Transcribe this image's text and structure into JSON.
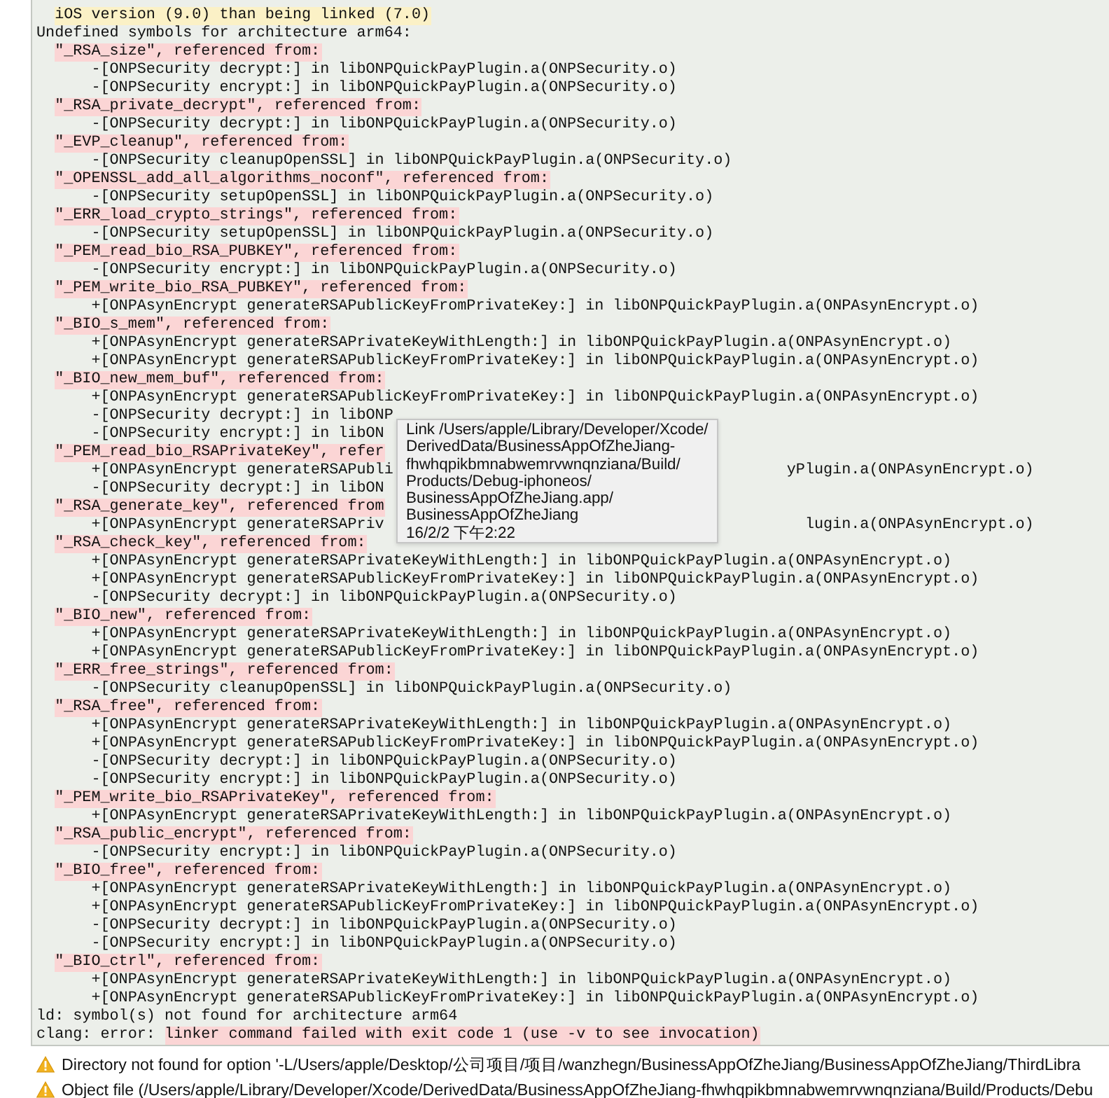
{
  "log": {
    "lines": [
      {
        "kind": "note",
        "text": "iOS version (9.0) than being linked (7.0)"
      },
      {
        "kind": "plain",
        "text": "Undefined symbols for architecture arm64:"
      },
      {
        "kind": "symbol",
        "text": "\"_RSA_size\", referenced from:"
      },
      {
        "kind": "ref",
        "text": "-[ONPSecurity decrypt:] in libONPQuickPayPlugin.a(ONPSecurity.o)"
      },
      {
        "kind": "ref",
        "text": "-[ONPSecurity encrypt:] in libONPQuickPayPlugin.a(ONPSecurity.o)"
      },
      {
        "kind": "symbol",
        "text": "\"_RSA_private_decrypt\", referenced from:"
      },
      {
        "kind": "ref",
        "text": "-[ONPSecurity decrypt:] in libONPQuickPayPlugin.a(ONPSecurity.o)"
      },
      {
        "kind": "symbol",
        "text": "\"_EVP_cleanup\", referenced from:"
      },
      {
        "kind": "ref",
        "text": "-[ONPSecurity cleanupOpenSSL] in libONPQuickPayPlugin.a(ONPSecurity.o)"
      },
      {
        "kind": "symbol",
        "text": "\"_OPENSSL_add_all_algorithms_noconf\", referenced from:"
      },
      {
        "kind": "ref",
        "text": "-[ONPSecurity setupOpenSSL] in libONPQuickPayPlugin.a(ONPSecurity.o)"
      },
      {
        "kind": "symbol",
        "text": "\"_ERR_load_crypto_strings\", referenced from:"
      },
      {
        "kind": "ref",
        "text": "-[ONPSecurity setupOpenSSL] in libONPQuickPayPlugin.a(ONPSecurity.o)"
      },
      {
        "kind": "symbol",
        "text": "\"_PEM_read_bio_RSA_PUBKEY\", referenced from:"
      },
      {
        "kind": "ref",
        "text": "-[ONPSecurity encrypt:] in libONPQuickPayPlugin.a(ONPSecurity.o)"
      },
      {
        "kind": "symbol",
        "text": "\"_PEM_write_bio_RSA_PUBKEY\", referenced from:"
      },
      {
        "kind": "ref",
        "text": "+[ONPAsynEncrypt generateRSAPublicKeyFromPrivateKey:] in libONPQuickPayPlugin.a(ONPAsynEncrypt.o)"
      },
      {
        "kind": "symbol",
        "text": "\"_BIO_s_mem\", referenced from:"
      },
      {
        "kind": "ref",
        "text": "+[ONPAsynEncrypt generateRSAPrivateKeyWithLength:] in libONPQuickPayPlugin.a(ONPAsynEncrypt.o)"
      },
      {
        "kind": "ref",
        "text": "+[ONPAsynEncrypt generateRSAPublicKeyFromPrivateKey:] in libONPQuickPayPlugin.a(ONPAsynEncrypt.o)"
      },
      {
        "kind": "symbol",
        "text": "\"_BIO_new_mem_buf\", referenced from:"
      },
      {
        "kind": "ref",
        "text": "+[ONPAsynEncrypt generateRSAPublicKeyFromPrivateKey:] in libONPQuickPayPlugin.a(ONPAsynEncrypt.o)"
      },
      {
        "kind": "ref",
        "text": "-[ONPSecurity decrypt:] in libONP"
      },
      {
        "kind": "ref",
        "text": "-[ONPSecurity encrypt:] in libON"
      },
      {
        "kind": "symbol",
        "text": "\"_PEM_read_bio_RSAPrivateKey\", refer"
      },
      {
        "kind": "ref",
        "text": "+[ONPAsynEncrypt generateRSAPubli",
        "tail": "yPlugin.a(ONPAsynEncrypt.o)"
      },
      {
        "kind": "ref",
        "text": "-[ONPSecurity decrypt:] in libON"
      },
      {
        "kind": "symbol",
        "text": "\"_RSA_generate_key\", referenced from"
      },
      {
        "kind": "ref",
        "text": "+[ONPAsynEncrypt generateRSAPriv",
        "tail": "lugin.a(ONPAsynEncrypt.o)"
      },
      {
        "kind": "symbol",
        "text": "\"_RSA_check_key\", referenced from:"
      },
      {
        "kind": "ref",
        "text": "+[ONPAsynEncrypt generateRSAPrivateKeyWithLength:] in libONPQuickPayPlugin.a(ONPAsynEncrypt.o)"
      },
      {
        "kind": "ref",
        "text": "+[ONPAsynEncrypt generateRSAPublicKeyFromPrivateKey:] in libONPQuickPayPlugin.a(ONPAsynEncrypt.o)"
      },
      {
        "kind": "ref",
        "text": "-[ONPSecurity decrypt:] in libONPQuickPayPlugin.a(ONPSecurity.o)"
      },
      {
        "kind": "symbol",
        "text": "\"_BIO_new\", referenced from:"
      },
      {
        "kind": "ref",
        "text": "+[ONPAsynEncrypt generateRSAPrivateKeyWithLength:] in libONPQuickPayPlugin.a(ONPAsynEncrypt.o)"
      },
      {
        "kind": "ref",
        "text": "+[ONPAsynEncrypt generateRSAPublicKeyFromPrivateKey:] in libONPQuickPayPlugin.a(ONPAsynEncrypt.o)"
      },
      {
        "kind": "symbol",
        "text": "\"_ERR_free_strings\", referenced from:"
      },
      {
        "kind": "ref",
        "text": "-[ONPSecurity cleanupOpenSSL] in libONPQuickPayPlugin.a(ONPSecurity.o)"
      },
      {
        "kind": "symbol",
        "text": "\"_RSA_free\", referenced from:"
      },
      {
        "kind": "ref",
        "text": "+[ONPAsynEncrypt generateRSAPrivateKeyWithLength:] in libONPQuickPayPlugin.a(ONPAsynEncrypt.o)"
      },
      {
        "kind": "ref",
        "text": "+[ONPAsynEncrypt generateRSAPublicKeyFromPrivateKey:] in libONPQuickPayPlugin.a(ONPAsynEncrypt.o)"
      },
      {
        "kind": "ref",
        "text": "-[ONPSecurity decrypt:] in libONPQuickPayPlugin.a(ONPSecurity.o)"
      },
      {
        "kind": "ref",
        "text": "-[ONPSecurity encrypt:] in libONPQuickPayPlugin.a(ONPSecurity.o)"
      },
      {
        "kind": "symbol",
        "text": "\"_PEM_write_bio_RSAPrivateKey\", referenced from:"
      },
      {
        "kind": "ref",
        "text": "+[ONPAsynEncrypt generateRSAPrivateKeyWithLength:] in libONPQuickPayPlugin.a(ONPAsynEncrypt.o)"
      },
      {
        "kind": "symbol",
        "text": "\"_RSA_public_encrypt\", referenced from:"
      },
      {
        "kind": "ref",
        "text": "-[ONPSecurity encrypt:] in libONPQuickPayPlugin.a(ONPSecurity.o)"
      },
      {
        "kind": "symbol",
        "text": "\"_BIO_free\", referenced from:"
      },
      {
        "kind": "ref",
        "text": "+[ONPAsynEncrypt generateRSAPrivateKeyWithLength:] in libONPQuickPayPlugin.a(ONPAsynEncrypt.o)"
      },
      {
        "kind": "ref",
        "text": "+[ONPAsynEncrypt generateRSAPublicKeyFromPrivateKey:] in libONPQuickPayPlugin.a(ONPAsynEncrypt.o)"
      },
      {
        "kind": "ref",
        "text": "-[ONPSecurity decrypt:] in libONPQuickPayPlugin.a(ONPSecurity.o)"
      },
      {
        "kind": "ref",
        "text": "-[ONPSecurity encrypt:] in libONPQuickPayPlugin.a(ONPSecurity.o)"
      },
      {
        "kind": "symbol",
        "text": "\"_BIO_ctrl\", referenced from:"
      },
      {
        "kind": "ref",
        "text": "+[ONPAsynEncrypt generateRSAPrivateKeyWithLength:] in libONPQuickPayPlugin.a(ONPAsynEncrypt.o)"
      },
      {
        "kind": "ref",
        "text": "+[ONPAsynEncrypt generateRSAPublicKeyFromPrivateKey:] in libONPQuickPayPlugin.a(ONPAsynEncrypt.o)"
      },
      {
        "kind": "plain",
        "text": "ld: symbol(s) not found for architecture arm64"
      },
      {
        "kind": "error",
        "text": "clang: error:",
        "highlight": "linker command failed with exit code 1 (use -v to see invocation)"
      }
    ]
  },
  "tooltip": {
    "lines": [
      "Link /Users/apple/Library/Developer/Xcode/",
      "DerivedData/BusinessAppOfZheJiang-",
      "fhwhqpikbmnabwemrvwnqnziana/Build/",
      "Products/Debug-iphoneos/",
      "BusinessAppOfZheJiang.app/",
      "BusinessAppOfZheJiang",
      "16/2/2 下午2:22"
    ]
  },
  "issues": [
    {
      "kind": "warning",
      "text": "Directory not found for option '-L/Users/apple/Desktop/公司项目/项目/wanzhegn/BusinessAppOfZheJiang/BusinessAppOfZheJiang/ThirdLibra"
    },
    {
      "kind": "warning",
      "text": "Object file (/Users/apple/Library/Developer/Xcode/DerivedData/BusinessAppOfZheJiang-fhwhqpikbmnabwemrvwnqnziana/Build/Products/Debu"
    }
  ]
}
